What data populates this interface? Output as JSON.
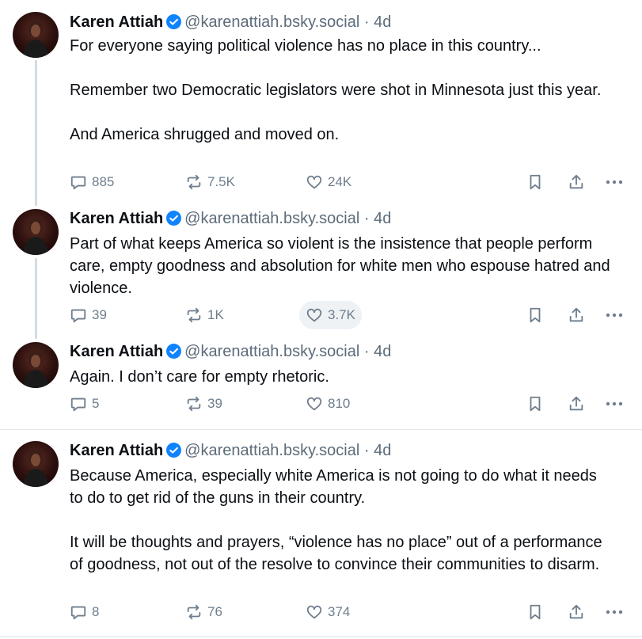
{
  "author": {
    "name": "Karen Attiah",
    "handle": "@karenattiah.bsky.social",
    "dot": "·"
  },
  "posts": [
    {
      "time": "4d",
      "paragraphs": [
        "For everyone saying political violence has no place in this country...",
        "Remember two Democratic legislators were shot in Minnesota just this year.",
        "And America shrugged and moved on."
      ],
      "replies": "885",
      "reposts": "7.5K",
      "likes": "24K"
    },
    {
      "time": "4d",
      "paragraphs": [
        "Part of what keeps America so violent is the insistence that people perform care, empty goodness and absolution for white men who espouse hatred and  violence."
      ],
      "replies": "39",
      "reposts": "1K",
      "likes": "3.7K"
    },
    {
      "time": "4d",
      "paragraphs": [
        "Again. I don’t care for empty rhetoric."
      ],
      "replies": "5",
      "reposts": "39",
      "likes": "810"
    },
    {
      "time": "4d",
      "paragraphs": [
        "Because America, especially white America is not going to do what it needs to do to get rid of the guns in their country.",
        "It will be thoughts and prayers, “violence has no place” out of a performance of goodness, not out of the resolve to convince their communities to disarm."
      ],
      "replies": "8",
      "reposts": "76",
      "likes": "374"
    }
  ],
  "icons": {
    "reply": "speech-bubble-icon",
    "repost": "repost-arrows-icon",
    "like": "heart-icon",
    "bookmark": "bookmark-icon",
    "share": "share-upload-icon",
    "more": "ellipsis-icon",
    "verified": "verified-check-icon"
  },
  "colors": {
    "verified": "#1083fe",
    "action_icon": "#6f7e8d",
    "thread_line": "#d4dbe2",
    "divider": "#e3e8ec"
  }
}
